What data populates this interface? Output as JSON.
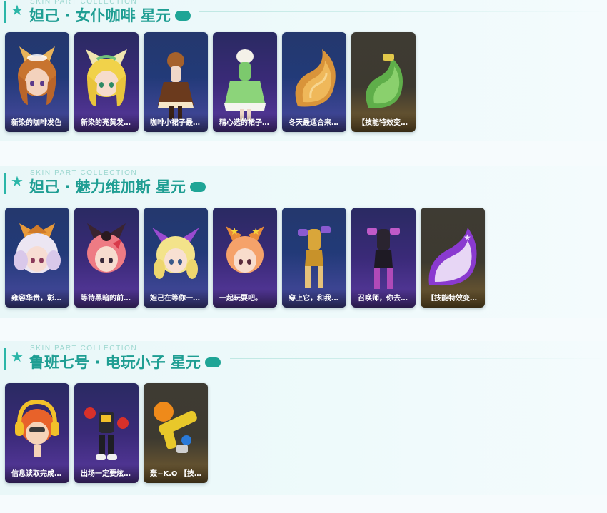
{
  "sections": [
    {
      "subtitle": "SKIN PART COLLECTION",
      "title": "妲己 · 女仆咖啡 星元",
      "items": [
        {
          "caption": "新染的咖啡发色",
          "icon": "coffee-hair-head-icon"
        },
        {
          "caption": "新染的亮黄发色...",
          "icon": "yellow-hair-head-icon"
        },
        {
          "caption": "咖啡小裙子最适...",
          "icon": "coffee-dress-icon"
        },
        {
          "caption": "精心选的裙子小...",
          "icon": "green-dress-icon"
        },
        {
          "caption": "冬天最适合来杯...",
          "icon": "golden-tail-icon"
        },
        {
          "caption": "【技能特效变化...",
          "icon": "green-tail-icon"
        }
      ]
    },
    {
      "subtitle": "SKIN PART COLLECTION",
      "title": "妲己 · 魅力维加斯 星元",
      "items": [
        {
          "caption": "雍容华贵，彰显...",
          "icon": "white-hair-head-icon"
        },
        {
          "caption": "等待黑暗的前一...",
          "icon": "pink-hair-head-icon"
        },
        {
          "caption": "妲己在等你一起...",
          "icon": "bow-hair-head-icon"
        },
        {
          "caption": "一起玩耍吧。",
          "icon": "star-hair-head-icon"
        },
        {
          "caption": "穿上它，和我一...",
          "icon": "gold-outfit-icon"
        },
        {
          "caption": "召唤师，你去爱...",
          "icon": "black-outfit-icon"
        },
        {
          "caption": "【技能特效变化...",
          "icon": "purple-tail-icon"
        }
      ]
    },
    {
      "subtitle": "SKIN PART COLLECTION",
      "title": "鲁班七号 · 电玩小子 星元",
      "items": [
        {
          "caption": "信息读取完成，...",
          "icon": "headphone-head-icon"
        },
        {
          "caption": "出场一定要炫酷...",
          "icon": "robot-outfit-icon"
        },
        {
          "caption": "轰~K.O 【技能...",
          "icon": "toy-blaster-icon"
        }
      ]
    }
  ],
  "colors": {
    "accent": "#2bb6a8",
    "title": "#1f9e93",
    "card_blue": "#223a78",
    "card_purple": "#3a2a78",
    "card_gold": "#3d3a30"
  }
}
